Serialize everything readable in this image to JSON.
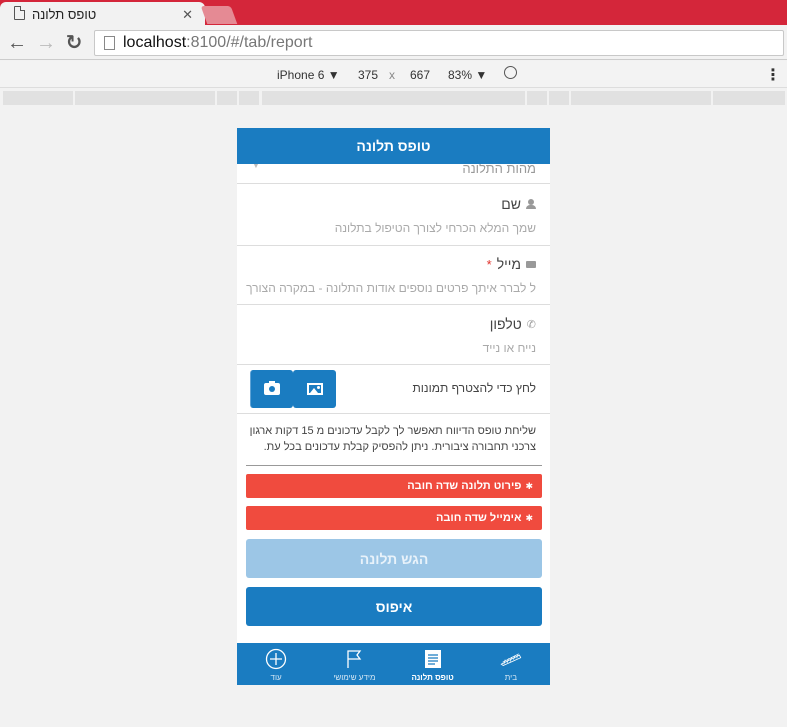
{
  "browser": {
    "tab_title": "טופס תלונה",
    "close_glyph": "✕",
    "url_host": "localhost",
    "url_path": ":8100/#/tab/report",
    "nav": {
      "back": "←",
      "forward": "→",
      "reload": "↻"
    }
  },
  "devtools": {
    "device": "iPhone 6 ▼",
    "width": "375",
    "times": "x",
    "height": "667",
    "zoom": "83% ▼",
    "menu": "⋮"
  },
  "app": {
    "header_title": "טופס תלונה",
    "cut_field_text": "מהות התלונה",
    "fields": [
      {
        "label": "שם",
        "placeholder": "שמך המלא הכרחי לצורך הטיפול בתלונה",
        "required": false,
        "icon": "person-icon"
      },
      {
        "label": "מייל",
        "required_mark": "*",
        "placeholder": "ל לברר איתך פרטים נוספים אודות התלונה - במקרה הצורך",
        "required": true,
        "icon": "mail-icon"
      },
      {
        "label": "טלפון",
        "placeholder": "נייח או נייד",
        "required": false,
        "icon": "phone-icon"
      }
    ],
    "photo_label": "לחץ כדי להצטרף תמונות",
    "notice": "שליחת טופס הדיווח תאפשר לך לקבל עדכונים מ 15 דקות ארגון צרכני תחבורה ציבורית. ניתן להפסיק קבלת עדכונים בכל עת.",
    "errors": [
      {
        "text": "פירוט תלונה שדה חובה",
        "icon": "bug-icon"
      },
      {
        "text": "אימייל שדה חובה",
        "icon": "bug-icon"
      }
    ],
    "submit_label": "הגש תלונה",
    "reset_label": "איפוס",
    "tabs": [
      {
        "label": "בית",
        "icon": "train-icon",
        "active": false
      },
      {
        "label": "טופס תלונה",
        "icon": "document-icon",
        "active": true
      },
      {
        "label": "מידע שימושי",
        "icon": "flag-icon",
        "active": false
      },
      {
        "label": "עוד",
        "icon": "plus-circle-icon",
        "active": false
      }
    ]
  },
  "colors": {
    "primary": "#1a7cc1",
    "error": "#f04b3e",
    "disabled": "#9cc6e6",
    "browser_frame": "#d4263a"
  }
}
